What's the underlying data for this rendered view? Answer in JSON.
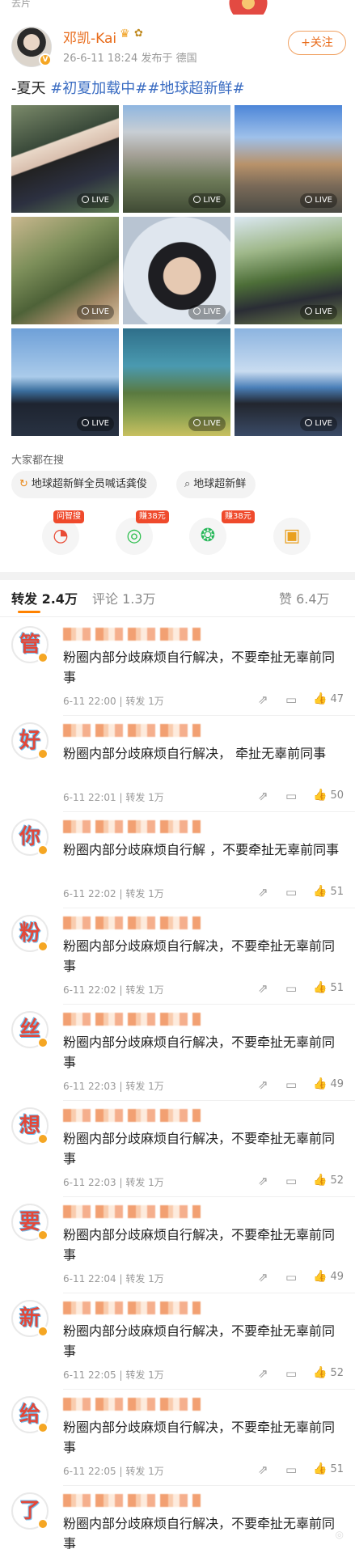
{
  "header": {
    "top_fragment": "去片",
    "username": "邓凯-Kai",
    "crown_icon": "crown-icon",
    "meta": "26-6-11 18:24  发布于 德国",
    "follow_label": "+关注"
  },
  "post": {
    "text_plain": "-夏天 ",
    "tag1": "#初夏加载中#",
    "tag2": "#地球超新鲜#",
    "live_label": "LIVE",
    "photo_count": 9
  },
  "search": {
    "title": "大家都在搜",
    "chips": [
      "地球超新鲜全员喊话龚俊",
      "地球超新鲜"
    ]
  },
  "actions": {
    "badges": [
      "问智搜",
      "赚38元",
      "赚38元"
    ]
  },
  "tabs": {
    "repost_label": "转发",
    "repost_count": "2.4万",
    "comment_label": "评论",
    "comment_count": "1.3万",
    "like_label": "赞",
    "like_count": "6.4万"
  },
  "comments": [
    {
      "avatar_char": "管",
      "text": "粉圈内部分歧麻烦自行解决，不要牵扯无辜前同事",
      "time": "6-11 22:00",
      "repost": "转发 1万",
      "likes": "47"
    },
    {
      "avatar_char": "好",
      "text": "粉圈内部分歧麻烦自行解决，  牵扯无辜前同事",
      "time": "6-11 22:01",
      "repost": "转发 1万",
      "likes": "50"
    },
    {
      "avatar_char": "你",
      "text": "粉圈内部分歧麻烦自行解  ，不要牵扯无辜前同事",
      "time": "6-11 22:02",
      "repost": "转发 1万",
      "likes": "51"
    },
    {
      "avatar_char": "粉",
      "text": "粉圈内部分歧麻烦自行解决，不要牵扯无辜前同事",
      "time": "6-11 22:02",
      "repost": "转发 1万",
      "likes": "51"
    },
    {
      "avatar_char": "丝",
      "text": "粉圈内部分歧麻烦自行解决，不要牵扯无辜前同事",
      "time": "6-11 22:03",
      "repost": "转发 1万",
      "likes": "49"
    },
    {
      "avatar_char": "想",
      "text": "粉圈内部分歧麻烦自行解决，不要牵扯无辜前同事",
      "time": "6-11 22:03",
      "repost": "转发 1万",
      "likes": "52"
    },
    {
      "avatar_char": "要",
      "text": "粉圈内部分歧麻烦自行解决，不要牵扯无辜前同事",
      "time": "6-11 22:04",
      "repost": "转发 1万",
      "likes": "49"
    },
    {
      "avatar_char": "新",
      "text": "粉圈内部分歧麻烦自行解决，不要牵扯无辜前同事",
      "time": "6-11 22:05",
      "repost": "转发 1万",
      "likes": "52"
    },
    {
      "avatar_char": "给",
      "text": "粉圈内部分歧麻烦自行解决，不要牵扯无辜前同事",
      "time": "6-11 22:05",
      "repost": "转发 1万",
      "likes": "51"
    },
    {
      "avatar_char": "了",
      "text": "粉圈内部分歧麻烦自行解决，不要牵扯无辜前同事",
      "time": "",
      "repost": "",
      "likes": ""
    }
  ]
}
